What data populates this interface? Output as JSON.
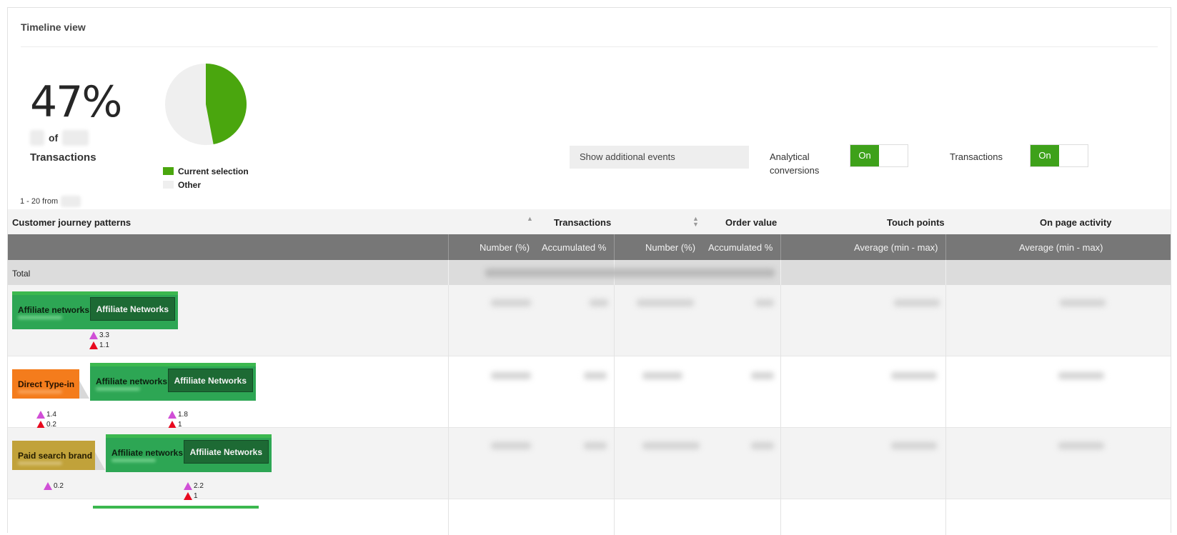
{
  "card": {
    "title": "Timeline view"
  },
  "summary": {
    "percent": "47%",
    "of_word": "of",
    "label": "Transactions",
    "range_prefix": "1 - 20 from"
  },
  "pie": {
    "current_fraction": 0.47,
    "current_color": "#4aa60e",
    "other_color": "#efefef",
    "legend": [
      "Current selection",
      "Other"
    ]
  },
  "controls": {
    "show_events": "Show additional events",
    "analytical_label": [
      "Analytical",
      "conversions"
    ],
    "analytical_state": "On",
    "transactions_label": "Transactions",
    "transactions_state": "On",
    "on_color": "#3ea11a"
  },
  "table": {
    "group_headers": [
      "Customer journey patterns",
      "Transactions",
      "Order value",
      "Touch points",
      "On page activity"
    ],
    "sub_headers": [
      "Number (%)",
      "Accumulated %",
      "Number (%)",
      "Accumulated %",
      "Average (min - max)",
      "Average (min - max)"
    ],
    "total_label": "Total",
    "rows": [
      {
        "steps": [
          {
            "label": "Affiliate networks",
            "detail": "Affiliate Networks",
            "color": "#2da654",
            "metrics": [
              "3.3",
              "1.1"
            ]
          }
        ]
      },
      {
        "steps": [
          {
            "label": "Direct Type-in",
            "color": "#f47c1c",
            "metrics": [
              "1.4",
              "0.2"
            ]
          },
          {
            "label": "Affiliate networks",
            "detail": "Affiliate Networks",
            "color": "#2da654",
            "metrics": [
              "1.8",
              "1"
            ]
          }
        ]
      },
      {
        "steps": [
          {
            "label": "Paid search brand",
            "color": "#c1a23a",
            "metrics": [
              "0.2"
            ]
          },
          {
            "label": "Affiliate networks",
            "detail": "Affiliate Networks",
            "color": "#2da654",
            "metrics": [
              "2.2",
              "1"
            ]
          }
        ]
      }
    ]
  }
}
